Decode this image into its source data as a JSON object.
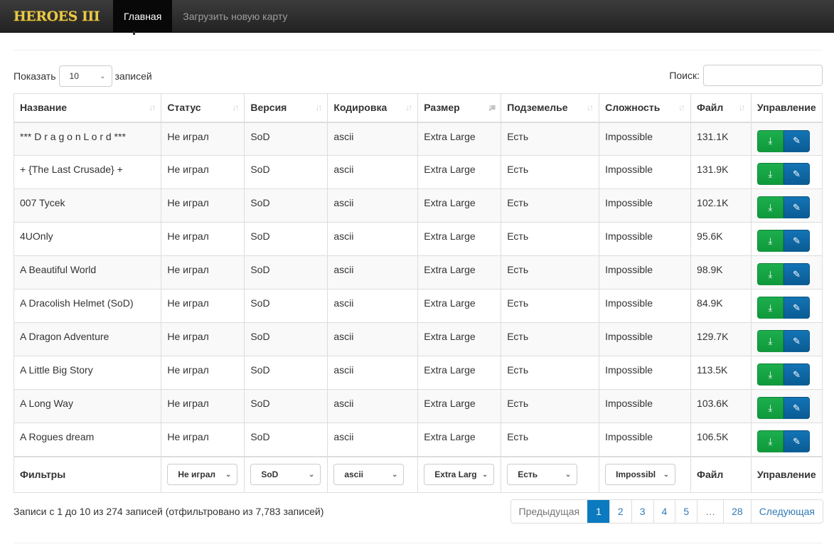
{
  "nav": {
    "logo": "HEROES III",
    "items": [
      {
        "label": "Главная",
        "active": true
      },
      {
        "label": "Загрузить новую карту"
      }
    ]
  },
  "length": {
    "prefix": "Показать",
    "value": "10",
    "suffix": "записей"
  },
  "search": {
    "label": "Поиск:",
    "value": ""
  },
  "columns": [
    "Название",
    "Статус",
    "Версия",
    "Кодировка",
    "Размер",
    "Подземелье",
    "Сложность",
    "Файл",
    "Управление"
  ],
  "rows": [
    [
      "*** D r a g o n L o r d ***",
      "Не играл",
      "SoD",
      "ascii",
      "Extra Large",
      "Есть",
      "Impossible",
      "131.1K"
    ],
    [
      "+ {The Last Crusade} +",
      "Не играл",
      "SoD",
      "ascii",
      "Extra Large",
      "Есть",
      "Impossible",
      "131.9K"
    ],
    [
      "007 Tycek",
      "Не играл",
      "SoD",
      "ascii",
      "Extra Large",
      "Есть",
      "Impossible",
      "102.1K"
    ],
    [
      "4UOnly",
      "Не играл",
      "SoD",
      "ascii",
      "Extra Large",
      "Есть",
      "Impossible",
      "95.6K"
    ],
    [
      "A Beautiful World",
      "Не играл",
      "SoD",
      "ascii",
      "Extra Large",
      "Есть",
      "Impossible",
      "98.9K"
    ],
    [
      "A Dracolish Helmet (SoD)",
      "Не играл",
      "SoD",
      "ascii",
      "Extra Large",
      "Есть",
      "Impossible",
      "84.9K"
    ],
    [
      "A Dragon Adventure",
      "Не играл",
      "SoD",
      "ascii",
      "Extra Large",
      "Есть",
      "Impossible",
      "129.7K"
    ],
    [
      "A Little Big Story",
      "Не играл",
      "SoD",
      "ascii",
      "Extra Large",
      "Есть",
      "Impossible",
      "113.5K"
    ],
    [
      "A Long Way",
      "Не играл",
      "SoD",
      "ascii",
      "Extra Large",
      "Есть",
      "Impossible",
      "103.6K"
    ],
    [
      "A Rogues dream",
      "Не играл",
      "SoD",
      "ascii",
      "Extra Large",
      "Есть",
      "Impossible",
      "106.5K"
    ]
  ],
  "filters": {
    "label": "Фильтры",
    "values": [
      "Не играл",
      "SoD",
      "ascii",
      "Extra Larg",
      "Есть",
      "Impossibl"
    ],
    "file": "Файл",
    "manage": "Управление"
  },
  "info": "Записи с 1 до 10 из 274 записей (отфильтровано из 7,783 записей)",
  "pagination": {
    "prev": "Предыдущая",
    "pages": [
      "1",
      "2",
      "3",
      "4",
      "5",
      "…",
      "28"
    ],
    "current": "1",
    "next": "Следующая"
  }
}
